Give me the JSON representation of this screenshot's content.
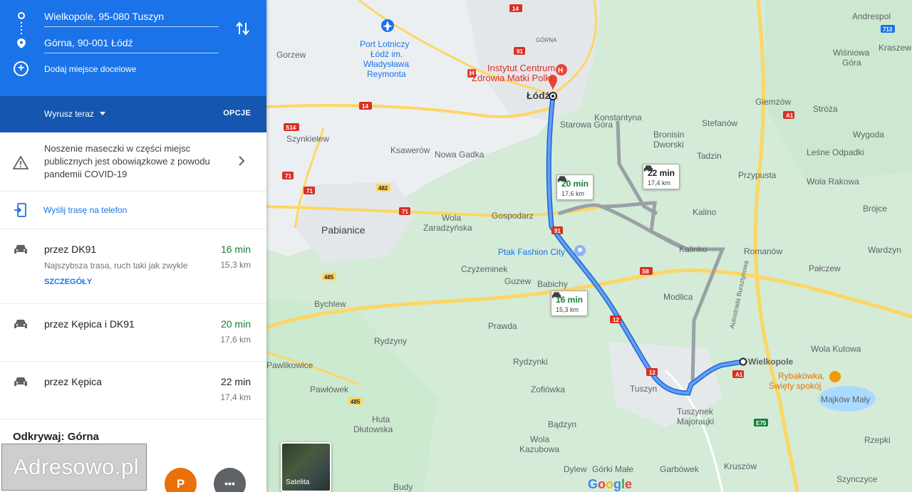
{
  "directions": {
    "origin": "Wielkopole, 95-080 Tuszyn",
    "destination": "Górna, 90-001 Łódź",
    "add_destination": "Dodaj miejsce docelowe",
    "depart_now": "Wyrusz teraz",
    "options": "OPCJE"
  },
  "alert": {
    "text": "Noszenie maseczki w części miejsc publicznych jest obowiązkowe z powodu pandemii COVID-19"
  },
  "send_to_phone": "Wyślij trasę na telefon",
  "routes": [
    {
      "name": "przez DK91",
      "time": "16 min",
      "distance": "15,3 km",
      "description": "Najszybsza trasa, ruch taki jak zwykle",
      "link": "SZCZEGÓŁY",
      "time_color": "#188038"
    },
    {
      "name": "przez Kępica i DK91",
      "time": "20 min",
      "distance": "17,6 km",
      "time_color": "#188038"
    },
    {
      "name": "przez Kępica",
      "time": "22 min",
      "distance": "17,4 km",
      "time_color": "#202124"
    }
  ],
  "explore": {
    "title": "Odkrywaj: Górna",
    "p_label": "P",
    "more_label": "•••"
  },
  "watermark": "Adresowo.pl",
  "map": {
    "callouts": [
      {
        "time": "16 min",
        "distance": "15,3 km",
        "time_color": "#188038"
      },
      {
        "time": "20 min",
        "distance": "17,6 km",
        "time_color": "#188038"
      },
      {
        "time": "22 min",
        "distance": "17,4 km",
        "time_color": "#202124"
      }
    ],
    "labels": {
      "lodz": "Łódź",
      "wielkopole": "Wielkopole",
      "pabianice": "Pabianice",
      "gorzew": "Gorzew",
      "szynkielew": "Szynkielew",
      "ksawerow": "Ksawerów",
      "nowa_gadka": "Nowa Gadka",
      "wola_zaradzynska_1": "Wola",
      "wola_zaradzynska_2": "Zaradzyńska",
      "gospodarz": "Gospodarz",
      "starowa_gora": "Starowa Góra",
      "konstantyna": "Konstantyna",
      "bronisin_1": "Bronisin",
      "bronisin_2": "Dworski",
      "tadzin": "Tadzin",
      "stefanow": "Stefanów",
      "giemzow": "Giemzów",
      "stroza": "Stróża",
      "wygoda": "Wygoda",
      "lesne_odpadki": "Leśne Odpadki",
      "przypusta": "Przypusta",
      "wola_rakowa": "Wola Rakowa",
      "brojce": "Brójce",
      "kalino": "Kalino",
      "kalinko": "Kalinko",
      "romanow": "Romanów",
      "wardzyn": "Wardzyn",
      "palczew": "Pałczew",
      "modlica": "Modlica",
      "czyzeminek": "Czyżeminek",
      "guzew": "Guzew",
      "babichy": "Babichy",
      "bychlew": "Bychlew",
      "prawda": "Prawda",
      "rydzyny": "Rydzyny",
      "rydzynki": "Rydzynki",
      "pawlikowice": "Pawlikowice",
      "pawlowek": "Pawłówek",
      "zofiowka": "Zofiówka",
      "tuszyn": "Tuszyn",
      "tuszynek_1": "Tuszynek",
      "tuszynek_2": "Majorацki",
      "huta_1": "Huta",
      "huta_2": "Dłutowska",
      "badzyn": "Bądzyn",
      "wola_kazubowa_1": "Wola",
      "wola_kazubowa_2": "Kazubowa",
      "dylew": "Dylew",
      "gorki_male": "Górki Małe",
      "garbowek": "Garbówek",
      "kruszow": "Kruszów",
      "szynczyce": "Szynczyce",
      "rzepki": "Rzepki",
      "majkow_maly": "Majków Mały",
      "wola_kutowa": "Wola Kutowa",
      "budy": "Budy",
      "andrespol": "Andrespol",
      "wisniowa_1": "Wiśniowa",
      "wisniowa_2": "Góra",
      "kraszew": "Kraszew",
      "gorna": "GÓRNA",
      "autostrada": "Autostrada Bursztynowa",
      "port_1": "Port Lotniczy",
      "port_2": "Łódź im.",
      "port_3": "Władysława",
      "port_4": "Reymonta",
      "instytut_1": "Instytut Centrum",
      "instytut_2": "Zdrowia Matki Polki",
      "ptak": "Ptak Fashion City",
      "rybakowka_1": "Rybakówka,",
      "rybakowka_2": "Święty spokój"
    },
    "road_numbers": [
      "14",
      "91",
      "14",
      "S14",
      "71",
      "71",
      "482",
      "71",
      "91",
      "485",
      "S8",
      "12",
      "12",
      "A1",
      "A1",
      "485",
      "713",
      "E75"
    ],
    "satellite_label": "Satelita",
    "google_logo": [
      "G",
      "o",
      "o",
      "g",
      "l",
      "e"
    ],
    "google_colors": [
      "#4285f4",
      "#ea4335",
      "#fbbc05",
      "#4285f4",
      "#34a853",
      "#ea4335"
    ]
  },
  "colors": {
    "header_blue": "#1a73e8",
    "depart_bar_blue": "#1557b0",
    "route_blue": "#4285f4",
    "alt_route_gray": "#9aa0a6",
    "map_green": "#d4ebd7",
    "urban_gray": "#e8eaed"
  }
}
